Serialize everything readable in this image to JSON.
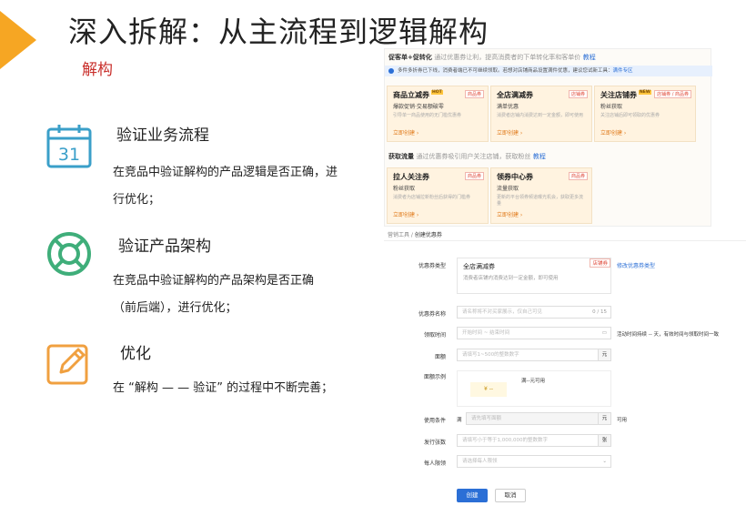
{
  "title": "深入拆解：从主流程到逻辑解构",
  "subtitle": "解构",
  "sections": [
    {
      "heading": "验证业务流程",
      "icon": "calendar-icon",
      "icon_text": "31",
      "lines": [
        "在竞品中验证解构的产品逻辑是否正确，进",
        "行优化；"
      ]
    },
    {
      "heading": "验证产品架构",
      "icon": "lifebuoy-icon",
      "lines": [
        "在竞品中验证解构的产品架构是否正确",
        "（前后端），进行优化；"
      ]
    },
    {
      "heading": "优化",
      "icon": "edit-icon",
      "lines": [
        "在 “解构 — — 验证” 的过程中不断完善；"
      ]
    }
  ],
  "colors": {
    "accent": "#f6a623",
    "icon": "#3a9fc9",
    "icon_green": "#3fae7a",
    "icon_orange": "#f0a040",
    "subtitle": "#c9302c"
  },
  "screenshot": {
    "promo": {
      "title": "促客单+促转化",
      "desc": "通过优惠券让利，提高消费者的下单转化率和客单价",
      "link": "教程"
    },
    "notice": {
      "text": "多件多折券已下线，消费者端已不可继续领取。若想对店铺商品设置满件优惠，建议您试新工具：",
      "link": "满件专区"
    },
    "cards_row1": [
      {
        "title": "商品立减券",
        "hot": "HOT",
        "sub": "爆款促销·交易额破零",
        "desc": "引导单一商品使用的无门槛优惠券",
        "tag": "商品券",
        "link": "立即创建 ›"
      },
      {
        "title": "全店满减券",
        "sub": "满单优惠",
        "desc": "消费者店铺内消费达到一定金额，即可使用",
        "tag": "店铺券",
        "link": "立即创建 ›"
      },
      {
        "title": "关注店铺券",
        "hot": "NEW",
        "sub": "粉丝获取",
        "desc": "关注店铺后即可领取的优惠券",
        "tag": "店铺券 / 商品券",
        "link": "立即创建 ›"
      }
    ],
    "traffic": {
      "title": "获取流量",
      "desc": "通过优惠券吸引用户关注店铺，获取粉丝",
      "link": "教程"
    },
    "cards_row2": [
      {
        "title": "拉人关注券",
        "sub": "粉丝获取",
        "desc": "消费者为店铺拉新粉丝后获得的门槛券",
        "tag": "商品券",
        "link": "立即创建 ›"
      },
      {
        "title": "领券中心券",
        "sub": "流量获取",
        "desc": "更新的平台领券频道曝光机会，获取更多流量",
        "tag": "商品券",
        "link": "立即创建 ›"
      }
    ],
    "breadcrumb": {
      "root": "营销工具",
      "sep": " / ",
      "current": "创建优惠券"
    },
    "form": {
      "type_label": "优惠券类型",
      "type_value": "全店满减券",
      "type_desc": "消费者店铺内消费达到一定金额，即可使用",
      "type_tag": "店铺券",
      "modify_link": "修改优惠券类型",
      "name_label": "优惠券名称",
      "name_placeholder": "请名称将不对买家展示，仅自己可见",
      "name_count": "0 / 15",
      "time_label": "领取时间",
      "time_placeholder": "开始时间  ~  结束时间",
      "time_note": "活动时间持续 -- 天，有效时间与领取时间一致",
      "amount_label": "面额",
      "amount_placeholder": "请填写1~500的整数数字",
      "amount_suffix": "元",
      "sample_label": "面额示例",
      "sample_value": "¥ --",
      "sample_text": "满--元可用",
      "cond_label": "使用条件",
      "cond_prefix": "满",
      "cond_placeholder": "请先填写面额",
      "cond_suffix": "元",
      "cond_note": "可用",
      "qty_label": "发行张数",
      "qty_placeholder": "请填写小于等于1,000,000的整数数字",
      "qty_suffix": "张",
      "limit_label": "每人限领",
      "limit_placeholder": "请选择每人限领",
      "create": "创建",
      "cancel": "取消"
    }
  }
}
